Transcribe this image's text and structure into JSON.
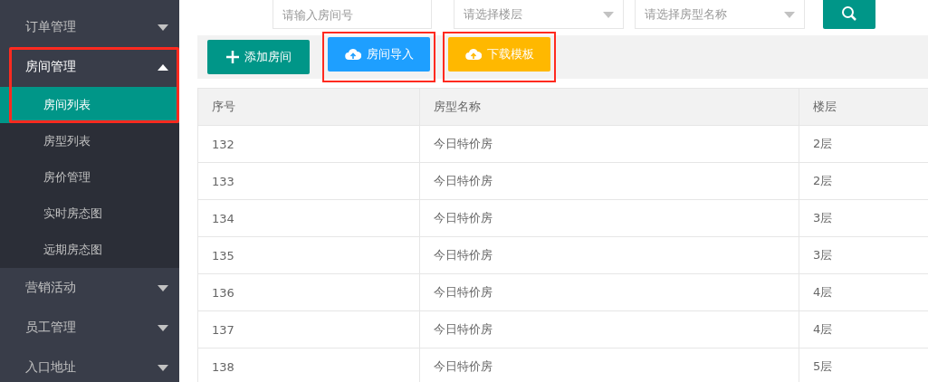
{
  "sidebar": {
    "groups": [
      {
        "label": "订单管理",
        "expanded": false,
        "highlighted": false
      },
      {
        "label": "房间管理",
        "expanded": true,
        "highlighted": true,
        "children": [
          {
            "label": "房间列表",
            "selected": true
          },
          {
            "label": "房型列表",
            "selected": false
          },
          {
            "label": "房价管理",
            "selected": false
          },
          {
            "label": "实时房态图",
            "selected": false
          },
          {
            "label": "远期房态图",
            "selected": false
          }
        ]
      },
      {
        "label": "营销活动",
        "expanded": false,
        "highlighted": false
      },
      {
        "label": "员工管理",
        "expanded": false,
        "highlighted": false
      },
      {
        "label": "入口地址",
        "expanded": false,
        "highlighted": false
      }
    ]
  },
  "search": {
    "fields": [
      {
        "kind": "input",
        "placeholder": "请输入房间号"
      },
      {
        "kind": "select",
        "placeholder": "请选择楼层"
      },
      {
        "kind": "select",
        "placeholder": "请选择房型名称"
      }
    ]
  },
  "toolbar": {
    "buttons": [
      {
        "kind": "add",
        "label": "添加房间",
        "highlighted": false
      },
      {
        "kind": "import",
        "label": "房间导入",
        "highlighted": true
      },
      {
        "kind": "download",
        "label": "下载模板",
        "highlighted": true
      }
    ]
  },
  "table": {
    "columns": [
      "序号",
      "房型名称",
      "楼层"
    ],
    "rows": [
      [
        "132",
        "今日特价房",
        "2层"
      ],
      [
        "133",
        "今日特价房",
        "2层"
      ],
      [
        "134",
        "今日特价房",
        "3层"
      ],
      [
        "135",
        "今日特价房",
        "3层"
      ],
      [
        "136",
        "今日特价房",
        "4层"
      ],
      [
        "137",
        "今日特价房",
        "4层"
      ],
      [
        "138",
        "今日特价房",
        "5层"
      ]
    ]
  }
}
